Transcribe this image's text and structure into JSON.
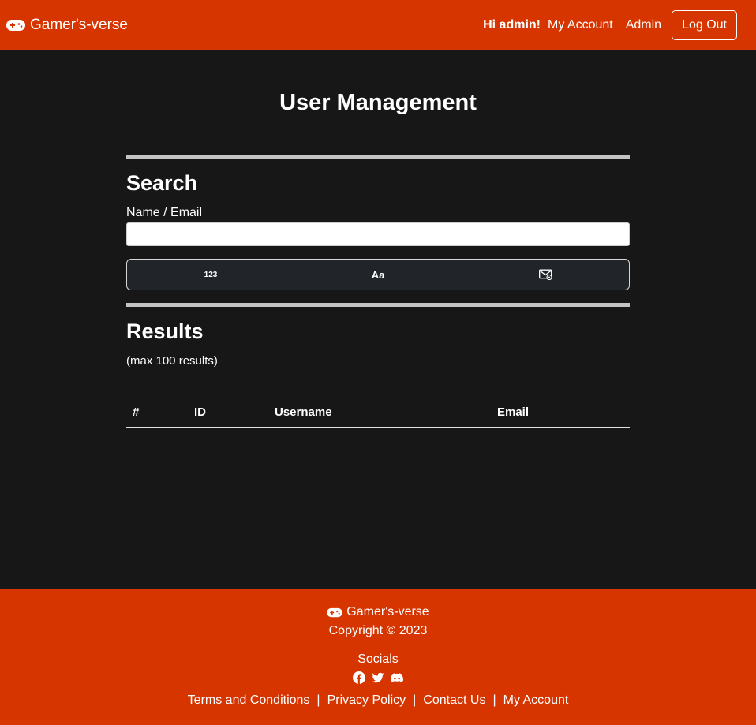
{
  "navbar": {
    "brand": "Gamer's-verse",
    "greeting": "Hi admin!",
    "my_account": "My Account",
    "admin": "Admin",
    "logout": "Log Out"
  },
  "main": {
    "title": "User Management",
    "search": {
      "heading": "Search",
      "label": "Name / Email",
      "value": "",
      "sort_buttons": [
        {
          "label": "123",
          "icon": "numeric-sort-icon"
        },
        {
          "label": "Aa",
          "icon": "alpha-sort-icon"
        },
        {
          "label": "",
          "icon": "envelope-at-icon"
        }
      ]
    },
    "results": {
      "heading": "Results",
      "note": "(max 100 results)",
      "columns": [
        "#",
        "ID",
        "Username",
        "Email"
      ],
      "rows": []
    }
  },
  "footer": {
    "brand": "Gamer's-verse",
    "copyright": "Copyright © 2023",
    "socials_label": "Socials",
    "socials": [
      "facebook-icon",
      "twitter-icon",
      "discord-icon"
    ],
    "links": [
      "Terms and Conditions",
      "Privacy Policy",
      "Contact Us",
      "My Account"
    ],
    "separator": "|"
  },
  "colors": {
    "brand": "#d63500",
    "background": "#171717",
    "button_group": "#212529",
    "rule": "#c4c4c4"
  }
}
